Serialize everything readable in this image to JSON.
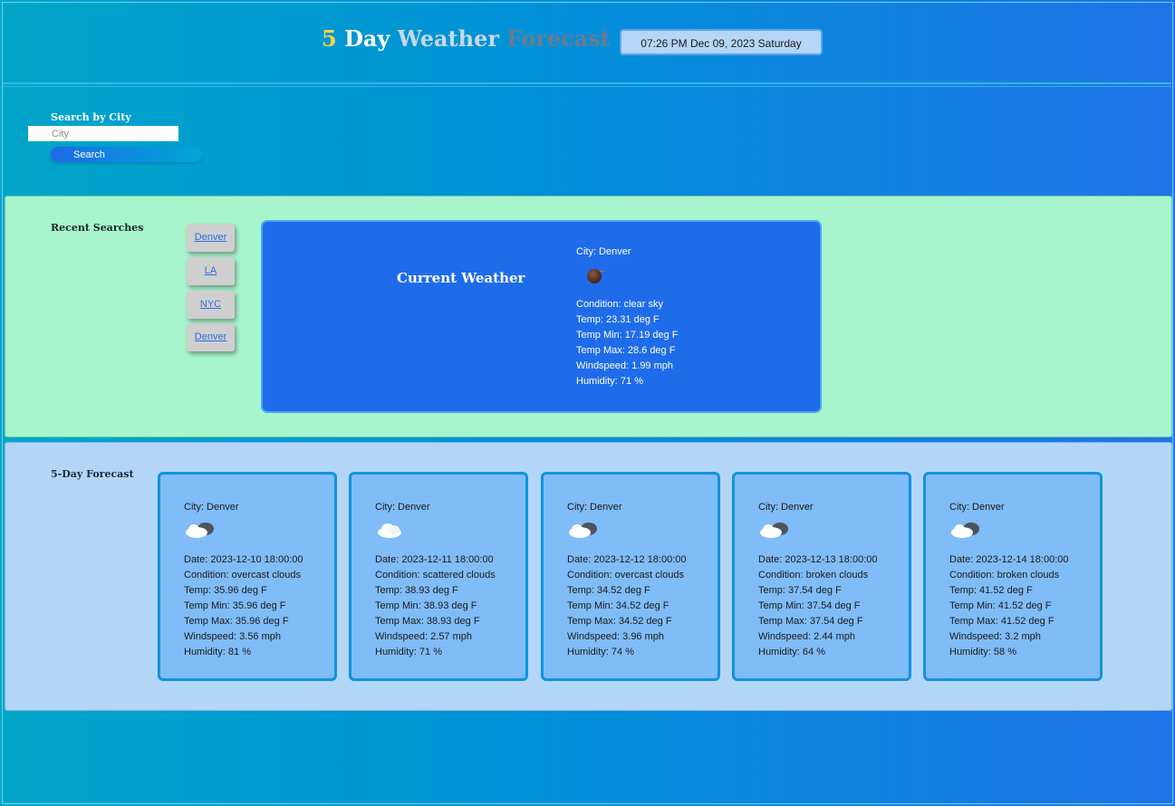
{
  "header": {
    "title_parts": [
      "5",
      "Day",
      "Weather",
      "Forecast"
    ],
    "datetime": "07:26 PM Dec 09, 2023 Saturday"
  },
  "search": {
    "label": "Search by City",
    "placeholder": "City",
    "button_label": "Search"
  },
  "recent": {
    "label": "Recent Searches",
    "items": [
      "Denver",
      "LA",
      "NYC",
      "Denver"
    ]
  },
  "current": {
    "title": "Current Weather",
    "city": "City: Denver",
    "icon": "clear-night-icon",
    "lines": [
      "Condition: clear sky",
      "Temp: 23.31 deg F",
      "Temp Min: 17.19 deg F",
      "Temp Max: 28.6 deg F",
      "Windspeed: 1.99 mph",
      "Humidity: 71 %"
    ]
  },
  "forecast": {
    "label": "5-Day Forecast",
    "cards": [
      {
        "city": "City: Denver",
        "icon": "overcast-clouds-icon",
        "lines": [
          "Date: 2023-12-10 18:00:00",
          "Condition: overcast clouds",
          "Temp: 35.96 deg F",
          "Temp Min: 35.96 deg F",
          "Temp Max: 35.96 deg F",
          "Windspeed: 3.56 mph",
          "Humidity: 81 %"
        ]
      },
      {
        "city": "City: Denver",
        "icon": "scattered-clouds-icon",
        "lines": [
          "Date: 2023-12-11 18:00:00",
          "Condition: scattered clouds",
          "Temp: 38.93 deg F",
          "Temp Min: 38.93 deg F",
          "Temp Max: 38.93 deg F",
          "Windspeed: 2.57 mph",
          "Humidity: 71 %"
        ]
      },
      {
        "city": "City: Denver",
        "icon": "overcast-clouds-icon",
        "lines": [
          "Date: 2023-12-12 18:00:00",
          "Condition: overcast clouds",
          "Temp: 34.52 deg F",
          "Temp Min: 34.52 deg F",
          "Temp Max: 34.52 deg F",
          "Windspeed: 3.96 mph",
          "Humidity: 74 %"
        ]
      },
      {
        "city": "City: Denver",
        "icon": "broken-clouds-icon",
        "lines": [
          "Date: 2023-12-13 18:00:00",
          "Condition: broken clouds",
          "Temp: 37.54 deg F",
          "Temp Min: 37.54 deg F",
          "Temp Max: 37.54 deg F",
          "Windspeed: 2.44 mph",
          "Humidity: 64 %"
        ]
      },
      {
        "city": "City: Denver",
        "icon": "broken-clouds-icon",
        "lines": [
          "Date: 2023-12-14 18:00:00",
          "Condition: broken clouds",
          "Temp: 41.52 deg F",
          "Temp Min: 41.52 deg F",
          "Temp Max: 41.52 deg F",
          "Windspeed: 3.2 mph",
          "Humidity: 58 %"
        ]
      }
    ]
  }
}
